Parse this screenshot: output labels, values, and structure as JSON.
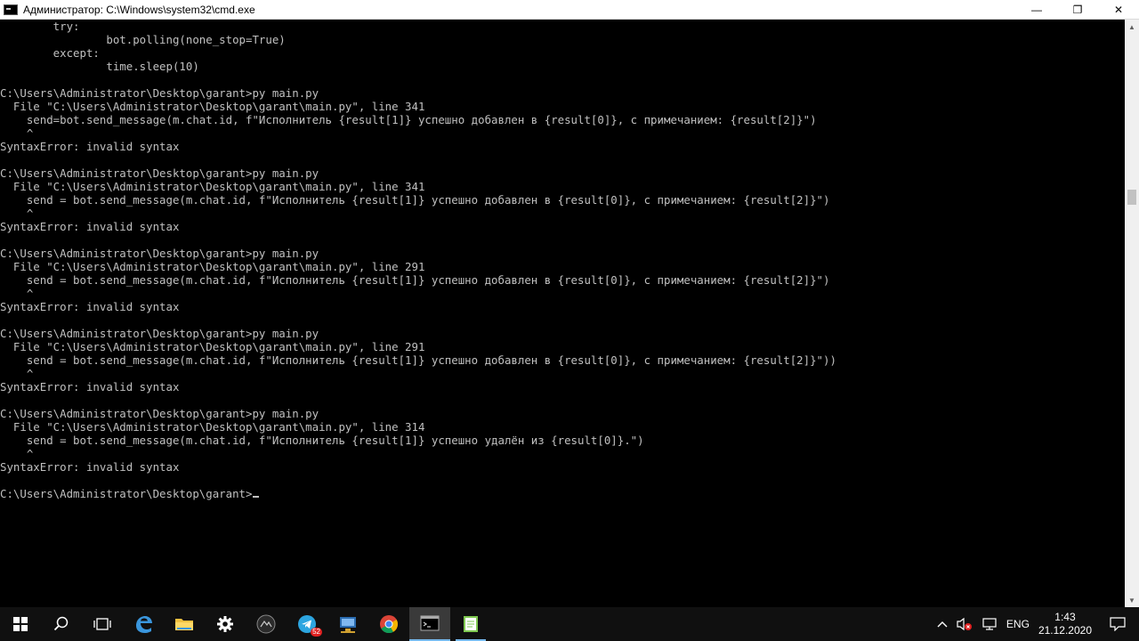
{
  "window": {
    "title": "Администратор: C:\\Windows\\system32\\cmd.exe",
    "buttons": {
      "minimize": "—",
      "restore": "❐",
      "close": "✕"
    }
  },
  "console": {
    "lines": [
      "        try:",
      "                bot.polling(none_stop=True)",
      "        except:",
      "                time.sleep(10)",
      "",
      "C:\\Users\\Administrator\\Desktop\\garant>py main.py",
      "  File \"C:\\Users\\Administrator\\Desktop\\garant\\main.py\", line 341",
      "    send=bot.send_message(m.chat.id, f\"Исполнитель {result[1]} успешно добавлен в {result[0]}, с примечанием: {result[2]}\")",
      "    ^",
      "SyntaxError: invalid syntax",
      "",
      "C:\\Users\\Administrator\\Desktop\\garant>py main.py",
      "  File \"C:\\Users\\Administrator\\Desktop\\garant\\main.py\", line 341",
      "    send = bot.send_message(m.chat.id, f\"Исполнитель {result[1]} успешно добавлен в {result[0]}, с примечанием: {result[2]}\")",
      "    ^",
      "SyntaxError: invalid syntax",
      "",
      "C:\\Users\\Administrator\\Desktop\\garant>py main.py",
      "  File \"C:\\Users\\Administrator\\Desktop\\garant\\main.py\", line 291",
      "    send = bot.send_message(m.chat.id, f\"Исполнитель {result[1]} успешно добавлен в {result[0]}, с примечанием: {result[2]}\")",
      "    ^",
      "SyntaxError: invalid syntax",
      "",
      "C:\\Users\\Administrator\\Desktop\\garant>py main.py",
      "  File \"C:\\Users\\Administrator\\Desktop\\garant\\main.py\", line 291",
      "    send = bot.send_message(m.chat.id, f\"Исполнитель {result[1]} успешно добавлен в {result[0]}, с примечанием: {result[2]}\"))",
      "    ^",
      "SyntaxError: invalid syntax",
      "",
      "C:\\Users\\Administrator\\Desktop\\garant>py main.py",
      "  File \"C:\\Users\\Administrator\\Desktop\\garant\\main.py\", line 314",
      "    send = bot.send_message(m.chat.id, f\"Исполнитель {result[1]} успешно удалён из {result[0]}.\")",
      "    ^",
      "SyntaxError: invalid syntax",
      ""
    ],
    "prompt": "C:\\Users\\Administrator\\Desktop\\garant>"
  },
  "scrollbar": {
    "up_glyph": "▲",
    "down_glyph": "▼"
  },
  "taskbar": {
    "items": [
      {
        "name": "start-button",
        "icon": "windows-logo-icon"
      },
      {
        "name": "search-button",
        "icon": "search-icon"
      },
      {
        "name": "task-view-button",
        "icon": "task-view-icon"
      },
      {
        "name": "edge-button",
        "icon": "edge-icon"
      },
      {
        "name": "file-explorer-button",
        "icon": "folder-icon"
      },
      {
        "name": "settings-button",
        "icon": "gear-icon"
      },
      {
        "name": "app-button",
        "icon": "app-circle-icon"
      },
      {
        "name": "telegram-button",
        "icon": "telegram-icon",
        "badge": "52"
      },
      {
        "name": "network-app-button",
        "icon": "network-app-icon"
      },
      {
        "name": "chrome-button",
        "icon": "chrome-icon"
      },
      {
        "name": "cmd-button",
        "icon": "cmd-icon"
      },
      {
        "name": "notepad-button",
        "icon": "notepad-icon"
      }
    ],
    "tray": {
      "language": "ENG",
      "time": "1:43",
      "date": "21.12.2020"
    }
  },
  "colors": {
    "console_text": "#c0c0c0",
    "console_bg": "#000000",
    "taskbar_bg": "#101010",
    "accent": "#76b9ed"
  }
}
